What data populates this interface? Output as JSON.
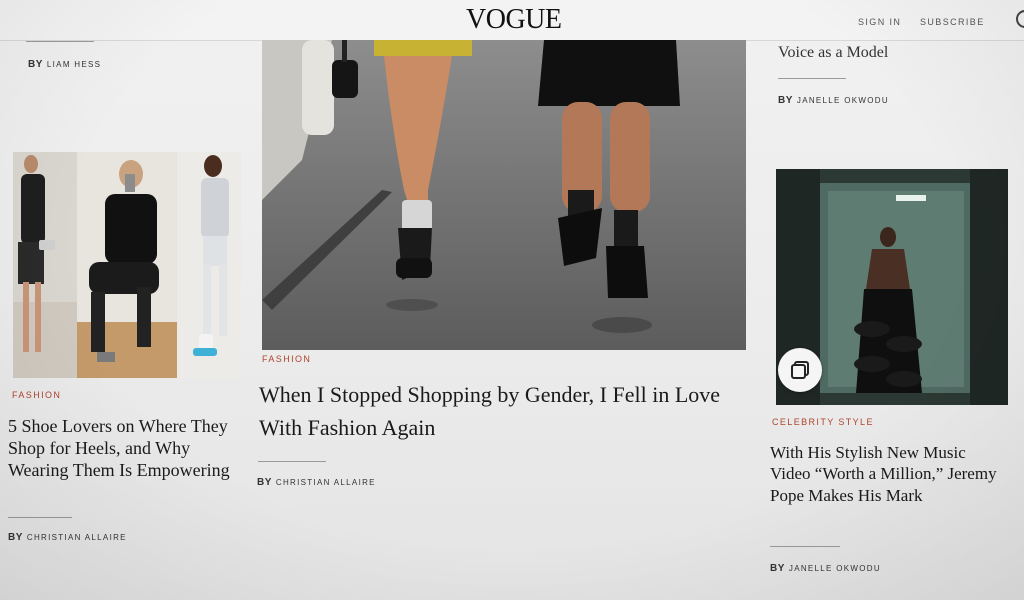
{
  "header": {
    "logo": "VOGUE",
    "sign_in": "SIGN IN",
    "subscribe": "SUBSCRIBE"
  },
  "left": {
    "top_byline_prefix": "BY",
    "top_byline_name": "LIAM HESS",
    "kicker": "FASHION",
    "headline": "5 Shoe Lovers on Where They Shop for Heels, and Why Wearing Them Is Empowering",
    "byline_prefix": "BY",
    "byline_name": "CHRISTIAN ALLAIRE"
  },
  "center": {
    "kicker": "FASHION",
    "headline": "When I Stopped Shopping by Gender, I Fell in Love With Fashion Again",
    "byline_prefix": "BY",
    "byline_name": "CHRISTIAN ALLAIRE"
  },
  "right": {
    "partial_title": "Voice as a Model",
    "top_byline_prefix": "BY",
    "top_byline_name": "JANELLE OKWODU",
    "kicker": "CELEBRITY STYLE",
    "headline": "With His Stylish New Music Video “Worth a Million,” Jeremy Pope Makes His Mark",
    "byline_prefix": "BY",
    "byline_name": "JANELLE OKWODU",
    "badge_icon": "gallery-icon"
  },
  "colors": {
    "kicker": "#b0432c",
    "text": "#1a1a1a",
    "background": "#ededed"
  }
}
